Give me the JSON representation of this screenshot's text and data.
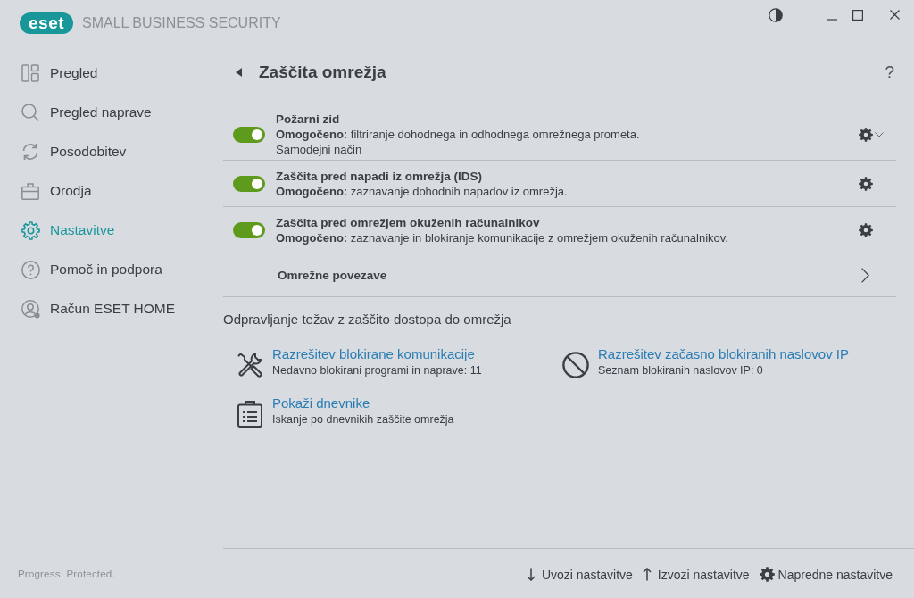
{
  "window": {
    "logo": "eset",
    "product": "SMALL BUSINESS SECURITY"
  },
  "sidebar": {
    "items": [
      {
        "label": "Pregled",
        "selected": false
      },
      {
        "label": "Pregled naprave",
        "selected": false
      },
      {
        "label": "Posodobitev",
        "selected": false
      },
      {
        "label": "Orodja",
        "selected": false
      },
      {
        "label": "Nastavitve",
        "selected": true
      },
      {
        "label": "Pomoč in podpora",
        "selected": false
      },
      {
        "label": "Račun ESET HOME",
        "selected": false
      }
    ],
    "tagline": "Progress. Protected."
  },
  "page": {
    "title": "Zaščita omrežja",
    "help": "?"
  },
  "protections": [
    {
      "kind": "toggle",
      "title": "Požarni zid",
      "on": true,
      "description": "**Omogočeno:** filtriranje dohodnega in odhodnega omrežnega prometa.",
      "note": "Samodejni način",
      "expandable": true
    },
    {
      "kind": "toggle",
      "title": "Zaščita pred napadi iz omrežja (IDS)",
      "on": true,
      "description": "**Omogočeno:** zaznavanje dohodnih napadov iz omrežja.",
      "expandable": false
    },
    {
      "kind": "toggle",
      "title": "Zaščita pred omrežjem okuženih računalnikov",
      "on": true,
      "description": "**Omogočeno:** zaznavanje in blokiranje komunikacije z omrežjem okuženih računalnikov.",
      "expandable": false
    },
    {
      "kind": "link",
      "title": "Omrežne povezave"
    }
  ],
  "troubleshooting": {
    "heading": "Odpravljanje težav z zaščito dostopa do omrežja",
    "actions": [
      {
        "title": "Razrešitev blokirane komunikacije",
        "subtitle": "Nedavno blokirani programi in naprave: 11"
      },
      {
        "title": "Razrešitev začasno blokiranih naslovov IP",
        "subtitle": "Seznam blokiranih naslovov IP: 0"
      },
      {
        "title": "Pokaži dnevnike",
        "subtitle": "Iskanje po dnevnikih zaščite omrežja"
      }
    ]
  },
  "footer": {
    "actions": [
      "Uvozi nastavitve",
      "Izvozi nastavitve",
      "Napredne nastavitve"
    ]
  }
}
